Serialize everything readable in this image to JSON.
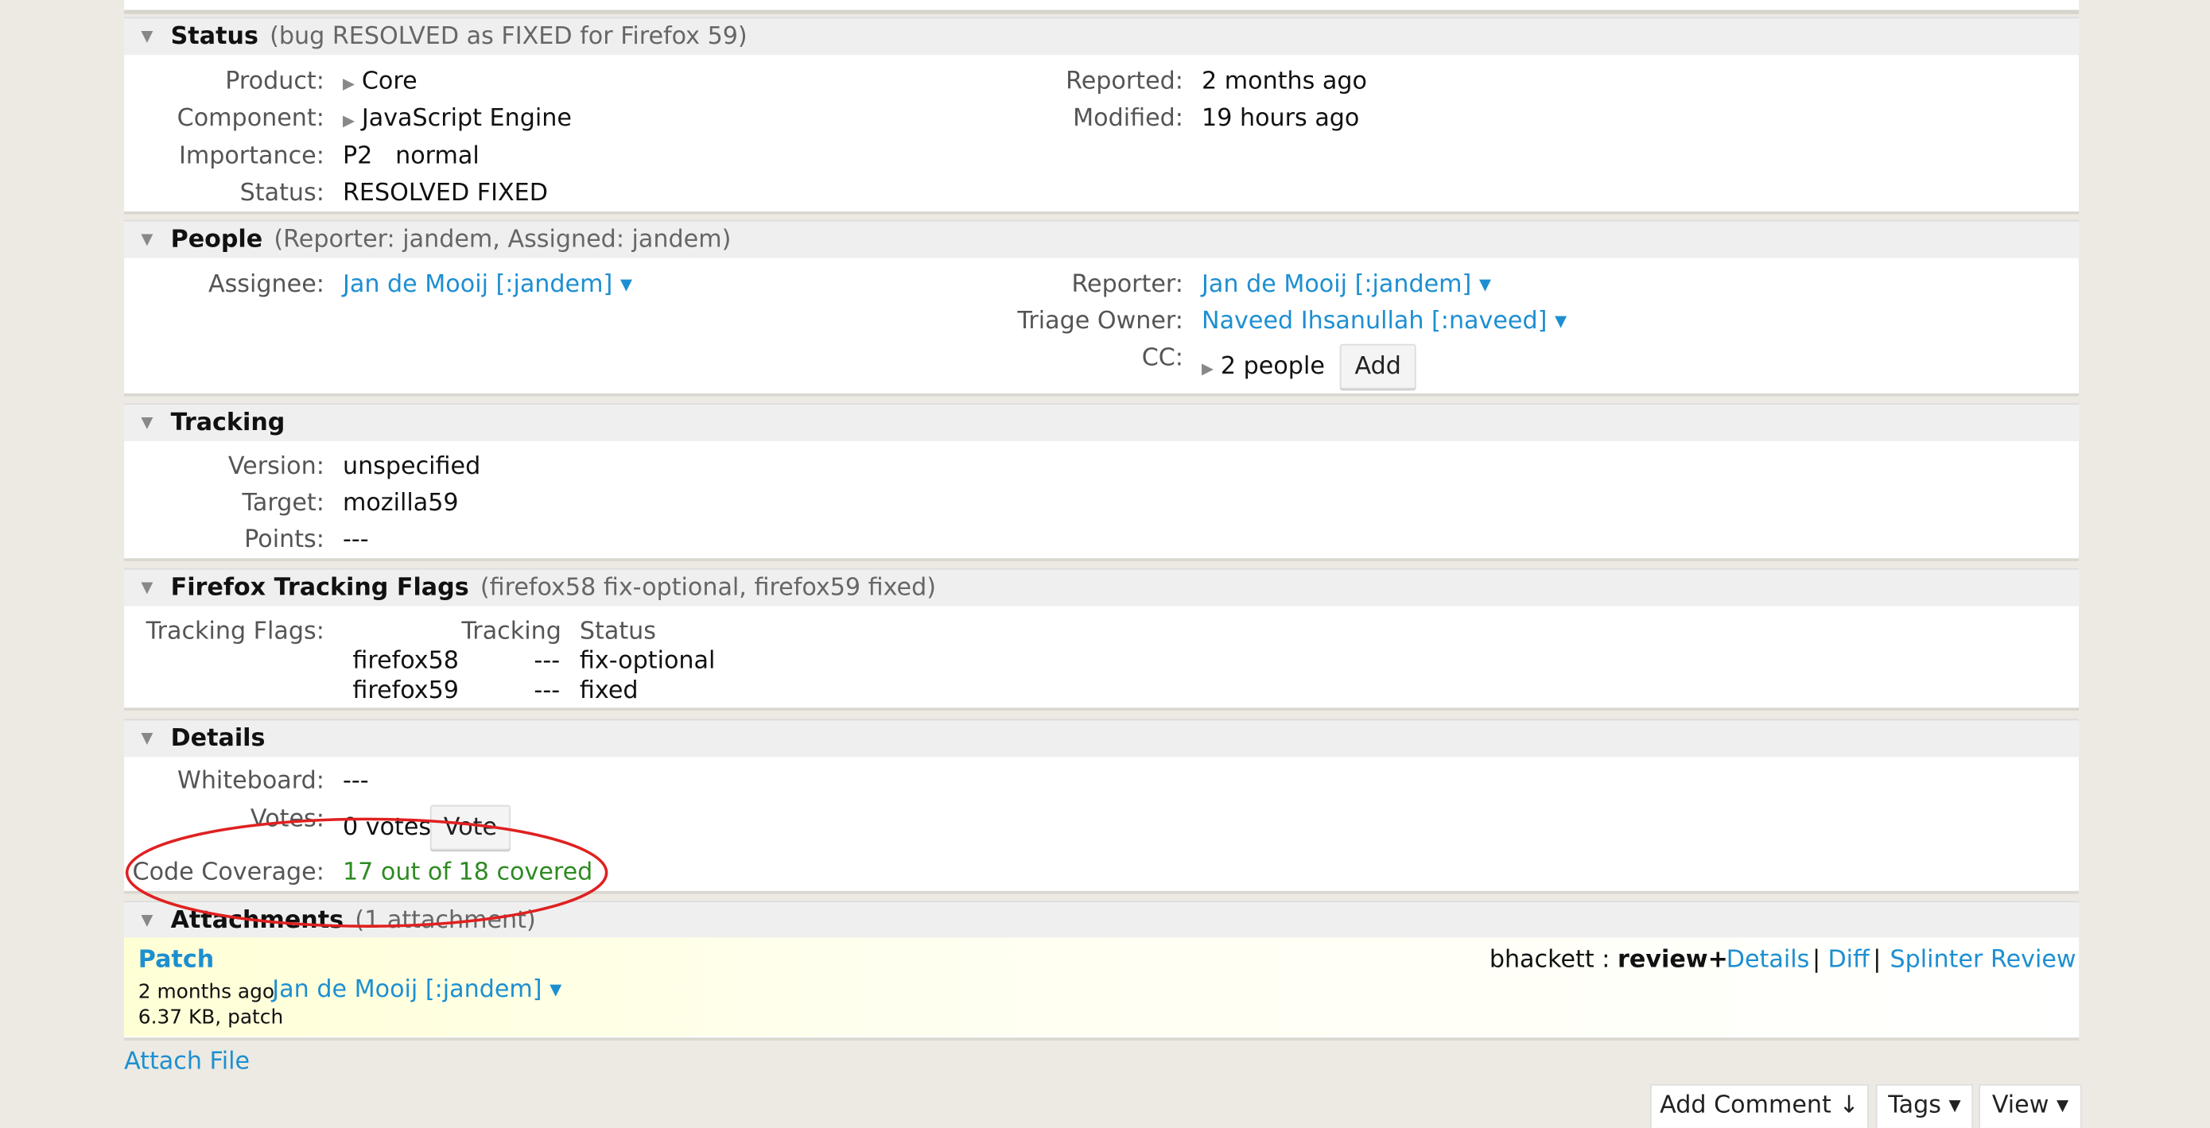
{
  "status": {
    "title": "Status",
    "summary": "(bug RESOLVED as FIXED for Firefox 59)",
    "product_label": "Product:",
    "product_value": "Core",
    "component_label": "Component:",
    "component_value": "JavaScript Engine",
    "importance_label": "Importance:",
    "importance_priority": "P2",
    "importance_severity": "normal",
    "status_label": "Status:",
    "status_value": "RESOLVED FIXED",
    "reported_label": "Reported:",
    "reported_value": "2 months ago",
    "modified_label": "Modified:",
    "modified_value": "19 hours ago"
  },
  "people": {
    "title": "People",
    "summary": "(Reporter: jandem, Assigned: jandem)",
    "assignee_label": "Assignee:",
    "assignee_value": "Jan de Mooij [:jandem] ▾",
    "reporter_label": "Reporter:",
    "reporter_value": "Jan de Mooij [:jandem] ▾",
    "triage_label": "Triage Owner:",
    "triage_value": "Naveed Ihsanullah [:naveed] ▾",
    "cc_label": "CC:",
    "cc_value": "2 people",
    "cc_add_button": "Add"
  },
  "tracking": {
    "title": "Tracking",
    "version_label": "Version:",
    "version_value": "unspecified",
    "target_label": "Target:",
    "target_value": "mozilla59",
    "points_label": "Points:",
    "points_value": "---"
  },
  "firefox_flags": {
    "title": "Firefox Tracking Flags",
    "summary": "(firefox58 fix-optional, firefox59 fixed)",
    "label": "Tracking Flags:",
    "col_tracking": "Tracking",
    "col_status": "Status",
    "rows": [
      {
        "name": "firefox58",
        "tracking": "---",
        "status": "fix-optional"
      },
      {
        "name": "firefox59",
        "tracking": "---",
        "status": "fixed"
      }
    ]
  },
  "details": {
    "title": "Details",
    "whiteboard_label": "Whiteboard:",
    "whiteboard_value": "---",
    "votes_label": "Votes:",
    "votes_value": "0 votes",
    "vote_button": "Vote",
    "coverage_label": "Code Coverage:",
    "coverage_value": "17 out of 18 covered"
  },
  "attachments": {
    "title": "Attachments",
    "summary": "(1 attachment)",
    "item": {
      "name": "Patch",
      "age": "2 months ago",
      "author": "Jan de Mooij [:jandem] ▾",
      "meta": "6.37 KB, patch",
      "reviewer": "bhackett :",
      "review_flag": "review+",
      "details_link": "Details",
      "diff_link": "Diff",
      "splinter_link": "Splinter Review",
      "separator": "|"
    },
    "attach_file": "Attach File"
  },
  "bottom_bar": {
    "add_comment": "Add Comment ↓",
    "tags": "Tags ▾",
    "view": "View ▾"
  },
  "colors": {
    "link": "#1d8fd1",
    "coverage_green": "#2e8b22",
    "highlight_ellipse": "#e02020",
    "background": "#eceae2"
  },
  "icons": {
    "collapse": "triangle-down-icon",
    "expand": "triangle-right-icon",
    "dropdown": "caret-down-icon"
  }
}
